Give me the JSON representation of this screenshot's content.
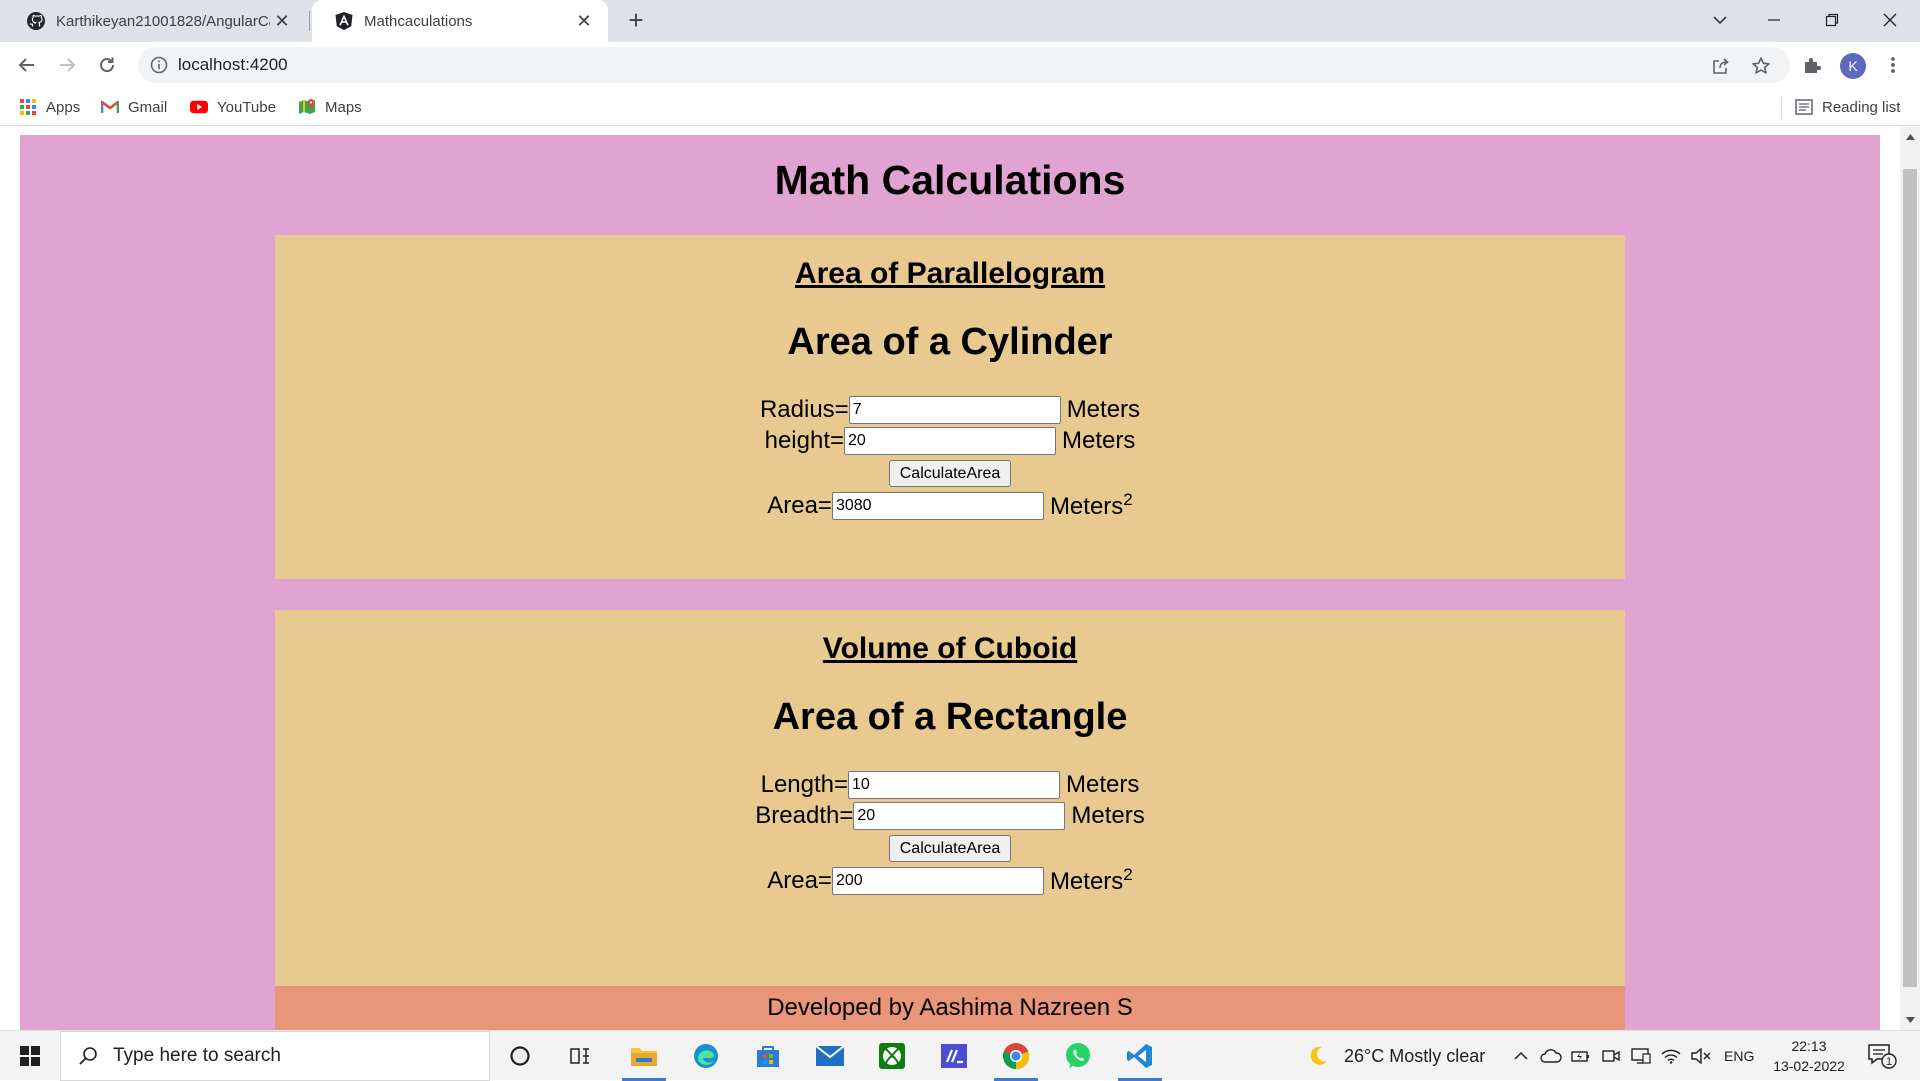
{
  "browser": {
    "tabs": [
      {
        "title": "Karthikeyan21001828/AngularCa",
        "icon": "github-icon",
        "active": false
      },
      {
        "title": "Mathcaculations",
        "icon": "angular-icon",
        "active": true
      }
    ],
    "url": "localhost:4200",
    "profile_initial": "K",
    "bookmarks": [
      {
        "label": "Apps",
        "icon": "apps-grid-icon"
      },
      {
        "label": "Gmail",
        "icon": "gmail-icon"
      },
      {
        "label": "YouTube",
        "icon": "youtube-icon"
      },
      {
        "label": "Maps",
        "icon": "maps-icon"
      }
    ],
    "reading_list_label": "Reading list"
  },
  "page": {
    "title": "Math Calculations",
    "background_color": "#e1a4d2",
    "card_color": "#e8ca91",
    "footer_color": "#e8957a",
    "cards": [
      {
        "heading": "Area of Parallelogram",
        "subtitle": "Area of a Cylinder",
        "fields": [
          {
            "label": "Radius=",
            "value": "7",
            "unit": "Meters"
          },
          {
            "label": "height=",
            "value": "20",
            "unit": "Meters"
          }
        ],
        "button_label": "CalculateArea",
        "result": {
          "label": "Area=",
          "value": "3080",
          "unit": "Meters",
          "unit_sup": "2"
        }
      },
      {
        "heading": "Volume of Cuboid",
        "subtitle": "Area of a Rectangle",
        "fields": [
          {
            "label": "Length=",
            "value": "10",
            "unit": "Meters"
          },
          {
            "label": "Breadth=",
            "value": "20",
            "unit": "Meters"
          }
        ],
        "button_label": "CalculateArea",
        "result": {
          "label": "Area=",
          "value": "200",
          "unit": "Meters",
          "unit_sup": "2"
        }
      }
    ],
    "footer": "Developed by Aashima Nazreen S"
  },
  "taskbar": {
    "search_placeholder": "Type here to search",
    "weather": "26°C  Mostly clear",
    "language": "ENG",
    "time": "22:13",
    "date": "13-02-2022",
    "notification_count": "1"
  }
}
